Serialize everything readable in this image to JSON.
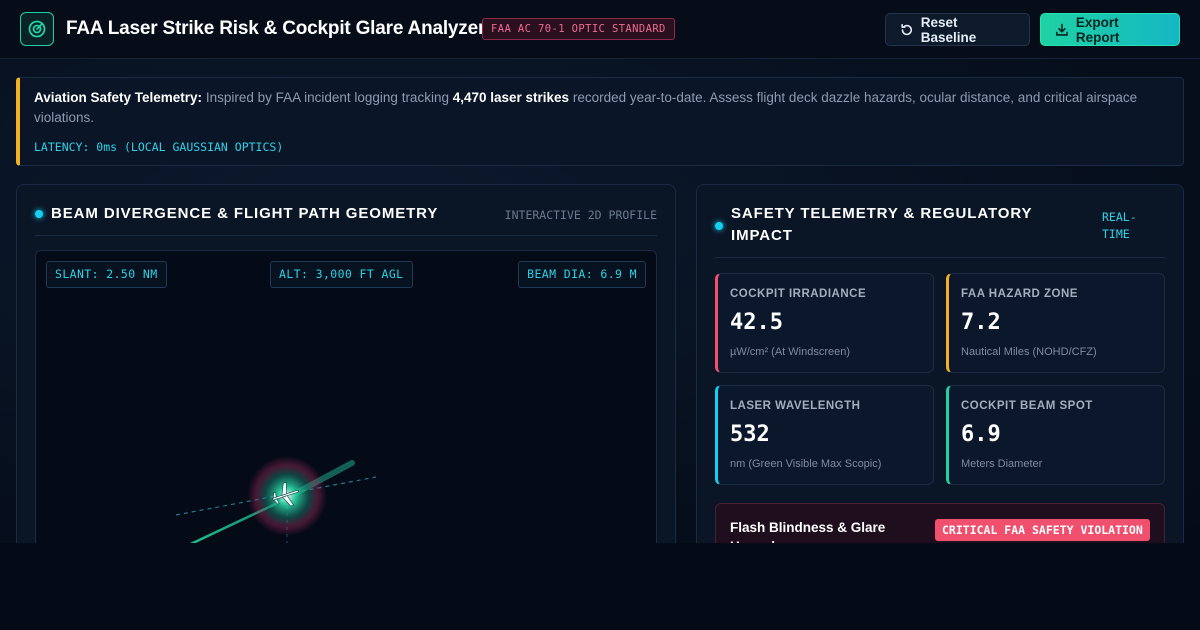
{
  "header": {
    "title": "FAA Laser Strike Risk & Cockpit Glare Analyzer",
    "standard_badge": "FAA AC 70-1 OPTIC STANDARD",
    "reset_label": "Reset Baseline",
    "export_label": "Export Report",
    "logo_icon": "radar-target-icon",
    "accent_color": "#1fd1a4"
  },
  "banner": {
    "lead": "Aviation Safety Telemetry:",
    "text_before": " Inspired by FAA incident logging tracking ",
    "highlight": "4,470 laser strikes",
    "text_after": " recorded year-to-date. Assess flight deck dazzle hazards, ocular distance, and critical airspace violations.",
    "latency": "LATENCY: 0ms (LOCAL GAUSSIAN OPTICS)",
    "accent_color": "#f5b021"
  },
  "geometry_panel": {
    "title": "BEAM DIVERGENCE & FLIGHT PATH GEOMETRY",
    "tag": "INTERACTIVE 2D PROFILE",
    "readouts": {
      "slant": "SLANT: 2.50 NM",
      "altitude": "ALT: 3,000 FT AGL",
      "beam_diameter": "BEAM DIA: 6.9 M"
    },
    "aircraft_icon": "airplane-icon"
  },
  "telemetry_panel": {
    "title": "SAFETY TELEMETRY & REGULATORY IMPACT",
    "tag": "REAL-TIME",
    "cards": [
      {
        "label": "COCKPIT IRRADIANCE",
        "value": "42.5",
        "unit": "µW/cm² (At Windscreen)",
        "color": "#f0506e"
      },
      {
        "label": "FAA HAZARD ZONE",
        "value": "7.2",
        "unit": "Nautical Miles (NOHD/CFZ)",
        "color": "#f5b021"
      },
      {
        "label": "LASER WAVELENGTH",
        "value": "532",
        "unit": "nm (Green Visible Max Scopic)",
        "color": "#14d0f0"
      },
      {
        "label": "COCKPIT BEAM SPOT",
        "value": "6.9",
        "unit": "Meters Diameter",
        "color": "#1fd1a4"
      }
    ],
    "alert": {
      "title": "Flash Blindness & Glare Hazard",
      "badge": "CRITICAL FAA SAFETY VIOLATION",
      "color": "#f0506e"
    }
  }
}
